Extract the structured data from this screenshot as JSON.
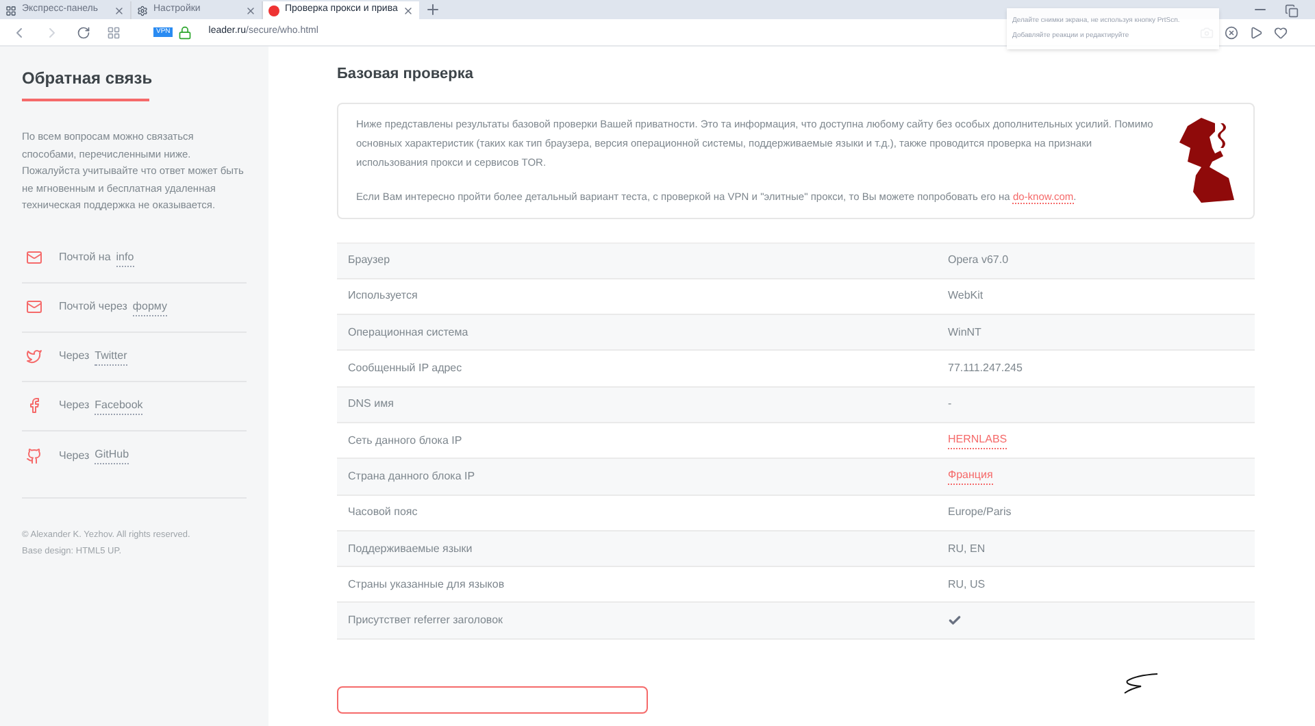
{
  "browser": {
    "tabs": [
      {
        "label": "Экспресс-панель",
        "selected": false
      },
      {
        "label": "Настройки",
        "selected": false
      },
      {
        "label": "Проверка прокси и прива",
        "selected": true
      }
    ],
    "url_host": "leader.ru",
    "url_path": "/secure/who.html",
    "vpn_badge": "VPN",
    "popup": {
      "line_1": "Делайте снимки экрана, не используя кнопку PrtScn.",
      "line_2": "Добавляйте реакции и редактируйте"
    }
  },
  "sidebar": {
    "title": "Обратная связь",
    "text": "По всем вопросам можно связаться способами, перечисленными ниже. Пожалуйста учитывайте что ответ может быть не мгновенным и бесплатная удаленная техническая поддержка не оказывается.",
    "items": [
      {
        "prefix": "Почтой на",
        "link": "info"
      },
      {
        "prefix": "Почтой через",
        "link": "форму"
      },
      {
        "prefix": "Через",
        "link": "Twitter"
      },
      {
        "prefix": "Через",
        "link": "Facebook"
      },
      {
        "prefix": "Через",
        "link": "GitHub"
      }
    ],
    "footer": [
      "© Alexander K. Yezhov. All rights reserved.",
      "Base design: HTML5 UP."
    ]
  },
  "main": {
    "title": "Базовая проверка",
    "intro_1": "Ниже представлены результаты базовой проверки Вашей приватности. Это та информация, что доступна любому сайту без особых дополнительных усилий. Помимо основных характеристик (таких как тип браузера, версия операционной системы, поддерживаемые языки и т.д.), также проводится проверка на признаки использования прокси и сервисов TOR.",
    "intro_2": "Если Вам интересно пройти более детальный вариант теста, с проверкой на VPN и \"элитные\" прокси, то Вы можете попробовать его на",
    "intro_link": "do-know.com",
    "intro_end": ".",
    "rows": [
      {
        "label": "Браузер",
        "kind": "text",
        "value": "Opera v67.0"
      },
      {
        "label": "Используется",
        "kind": "text",
        "value": "WebKit"
      },
      {
        "label": "Операционная система",
        "kind": "text",
        "value": "WinNT"
      },
      {
        "label": "Сообщенный IP адрес",
        "kind": "text",
        "value": "77.111.247.245"
      },
      {
        "label": "DNS имя",
        "kind": "text",
        "value": "-"
      },
      {
        "label": "Сеть данного блока IP",
        "kind": "link",
        "value": "HERNLABS"
      },
      {
        "label": "Страна данного блока IP",
        "kind": "link",
        "value": "Франция"
      },
      {
        "label": "Часовой пояс",
        "kind": "text",
        "value": "Europe/Paris"
      },
      {
        "label": "Поддерживаемые языки",
        "kind": "text",
        "value": "RU, EN"
      },
      {
        "label": "Страны указанные для языков",
        "kind": "text",
        "value": "RU, US"
      },
      {
        "label": "Присутствет referrer заголовок",
        "kind": "check",
        "checked": true
      }
    ]
  }
}
